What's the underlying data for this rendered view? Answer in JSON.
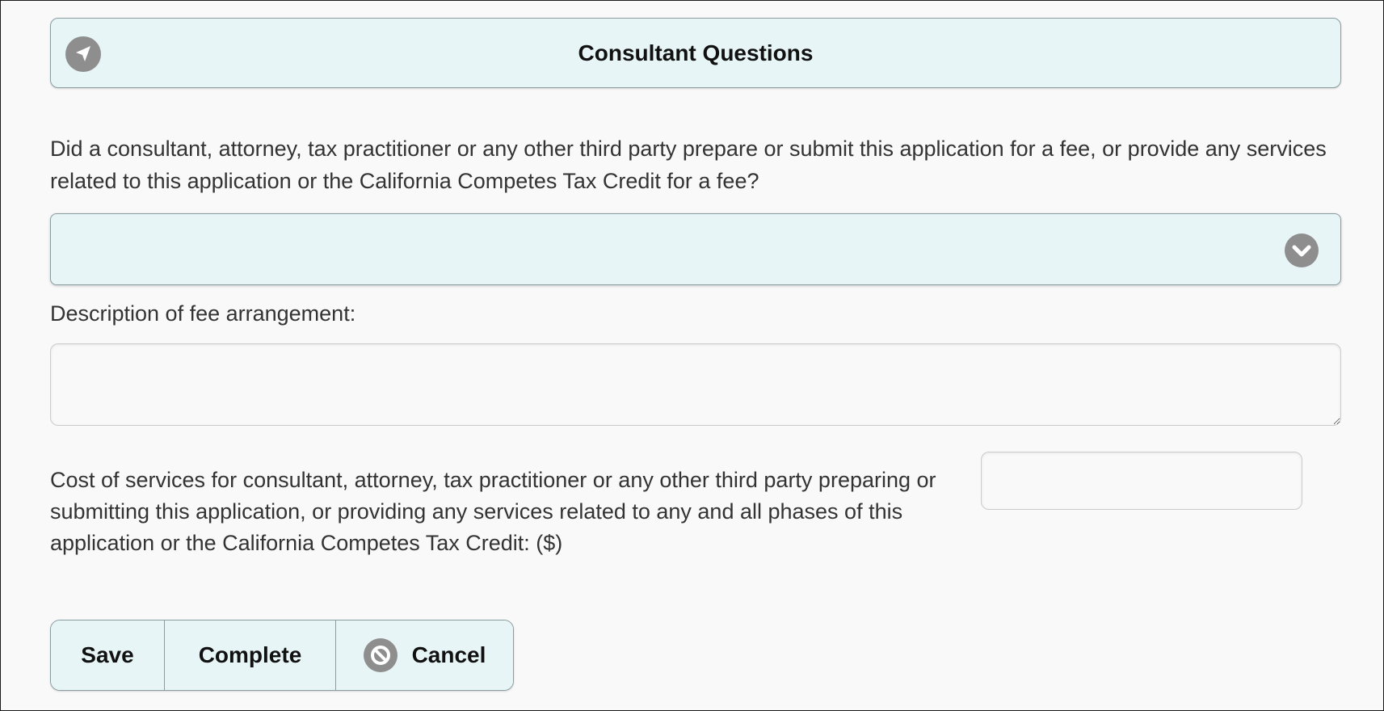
{
  "header": {
    "title": "Consultant Questions",
    "icon": "navigation-arrow-icon"
  },
  "question": {
    "text": "Did a consultant, attorney, tax practitioner or any other third party prepare or submit this application for a fee, or provide any services related to this application or the California Competes Tax Credit for a fee?",
    "selected_value": ""
  },
  "description": {
    "label": "Description of fee arrangement:",
    "value": ""
  },
  "cost": {
    "label": "Cost of services for consultant, attorney, tax practitioner or any other third party preparing or submitting this application, or providing any services related to any and all phases of this application or the California Competes Tax Credit: ($)",
    "value": ""
  },
  "actions": {
    "save_label": "Save",
    "complete_label": "Complete",
    "cancel_label": "Cancel",
    "cancel_icon": "cancel-icon"
  },
  "colors": {
    "panel_bg": "#e8f5f6",
    "border": "#8a9ea2",
    "icon_gray": "#8e8e8e"
  }
}
